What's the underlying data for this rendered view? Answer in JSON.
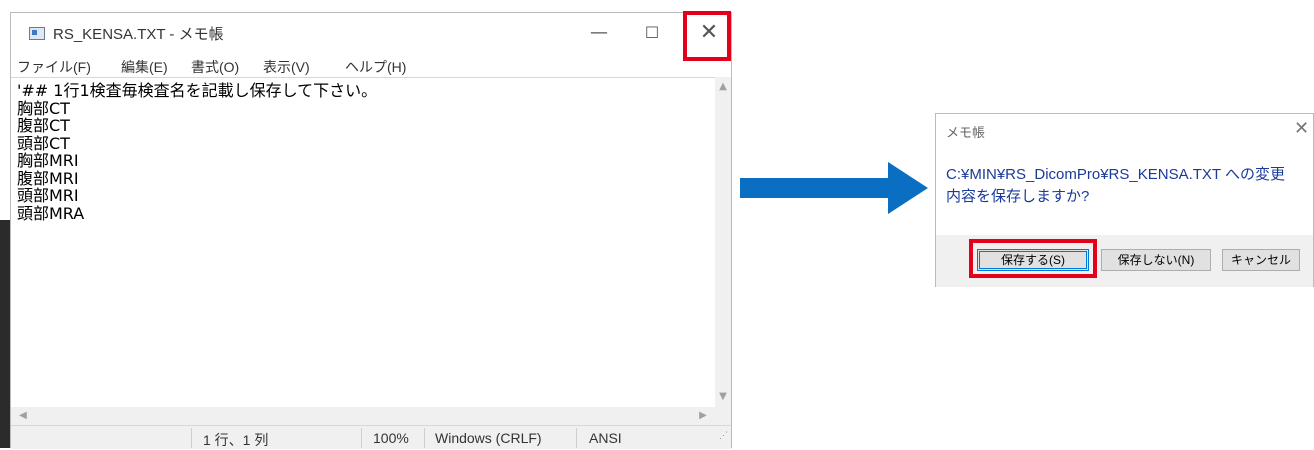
{
  "notepad": {
    "title": "RS_KENSA.TXT - メモ帳",
    "window_buttons": {
      "minimize": "—",
      "maximize": "☐",
      "close": "✕"
    },
    "menu": [
      "ファイル(F)",
      "編集(E)",
      "書式(O)",
      "表示(V)",
      "ヘルプ(H)"
    ],
    "lines": [
      "'## 1行1検査毎検査名を記載し保存して下さい。",
      "胸部CT",
      "腹部CT",
      "頭部CT",
      "胸部MRI",
      "腹部MRI",
      "頭部MRI",
      "頭部MRA"
    ],
    "status": {
      "position": "1 行、1 列",
      "zoom": "100%",
      "line_ending": "Windows (CRLF)",
      "encoding": "ANSI"
    }
  },
  "arrow": {
    "color": "#0a6fc2",
    "icon": "right-arrow-icon"
  },
  "dialog": {
    "title": "メモ帳",
    "close": "✕",
    "message_line1": "C:¥MIN¥RS_DicomPro¥RS_KENSA.TXT への変更",
    "message_line2": "内容を保存しますか?",
    "buttons": {
      "save": "保存する(S)",
      "dont_save": "保存しない(N)",
      "cancel": "キャンセル"
    }
  },
  "highlight_color": "#e3001b"
}
